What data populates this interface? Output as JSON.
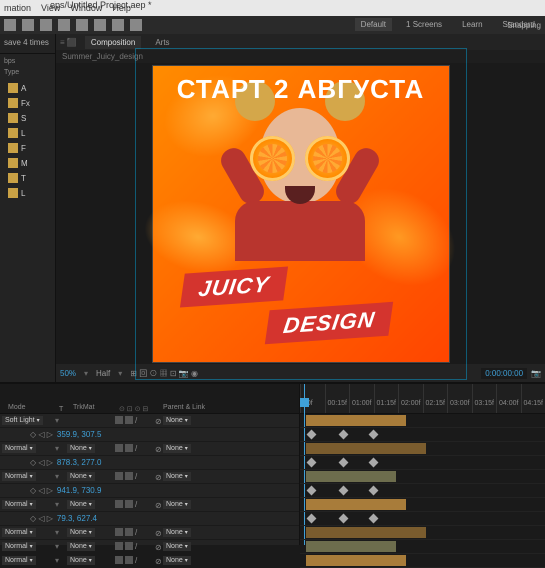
{
  "titlebar": "eps/Untitled Project.aep *",
  "menubar": [
    "mation",
    "View",
    "Window",
    "Help"
  ],
  "workspace": {
    "active": "Default",
    "items": [
      "Default",
      "1 Screens",
      "Learn",
      "Standard"
    ]
  },
  "snapping": "Snapping",
  "project": {
    "header": "save 4 times",
    "info_label": "bps",
    "tree_header": "Type",
    "folders": [
      "A",
      "Fx",
      "S",
      "L",
      "F",
      "M",
      "T",
      "L"
    ]
  },
  "comp": {
    "tabs": [
      "Composition",
      "Arts"
    ],
    "name": "Summer_Juicy_design",
    "overlay_title": "СТАРТ 2 АВГУСТА",
    "banner1": "JUICY",
    "banner2": "DESIGN"
  },
  "footer": {
    "zoom": "50%",
    "quality": "Half",
    "time": "0:00:00:00",
    "icons": "⊞ 回 ⊙ ▦ ⊡ 📷 ◉"
  },
  "timeline": {
    "headers": {
      "mode": "Mode",
      "trkmat": "TrkMat",
      "parent": "Parent & Link"
    },
    "ruler": [
      "00f",
      "00:15f",
      "01:00f",
      "01:15f",
      "02:00f",
      "02:15f",
      "03:00f",
      "03:15f",
      "04:00f",
      "04:15f"
    ],
    "layers": [
      {
        "mode": "Soft Light",
        "trkmat": "",
        "parent": "None",
        "prop": "359.9, 307.5"
      },
      {
        "mode": "Normal",
        "trkmat": "None",
        "parent": "None",
        "prop": "878.3, 277.0"
      },
      {
        "mode": "Normal",
        "trkmat": "None",
        "parent": "None",
        "prop": "941.9, 730.9"
      },
      {
        "mode": "Normal",
        "trkmat": "None",
        "parent": "None",
        "prop": "79.3, 627.4"
      },
      {
        "mode": "Normal",
        "trkmat": "None",
        "parent": "None"
      },
      {
        "mode": "Normal",
        "trkmat": "None",
        "parent": "None"
      },
      {
        "mode": "Normal",
        "trkmat": "None",
        "parent": "None"
      }
    ],
    "none_label": "None"
  }
}
